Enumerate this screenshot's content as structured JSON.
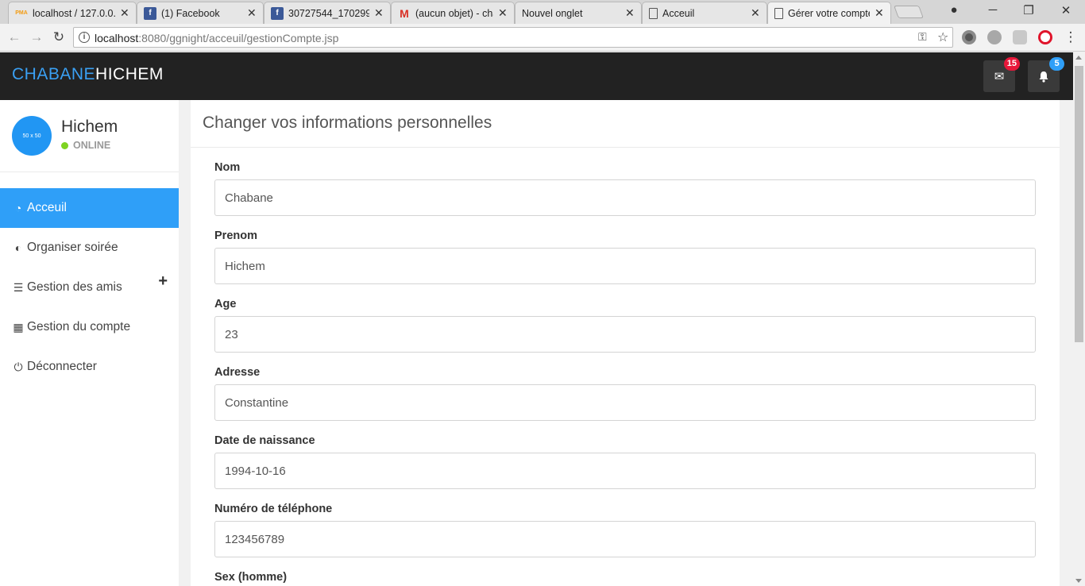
{
  "browser": {
    "tabs": [
      {
        "title": "localhost / 127.0.0.",
        "icon": "phpmyadmin-icon",
        "fav": "PMA"
      },
      {
        "title": "(1) Facebook",
        "icon": "facebook-icon",
        "fav": "f"
      },
      {
        "title": "30727544_170299",
        "icon": "facebook-icon",
        "fav": "f"
      },
      {
        "title": "(aucun objet) - cha",
        "icon": "gmail-icon",
        "fav": "M"
      },
      {
        "title": "Nouvel onglet",
        "icon": "",
        "fav": ""
      },
      {
        "title": "Acceuil",
        "icon": "document-icon",
        "fav": ""
      },
      {
        "title": "Gérer votre compte",
        "icon": "document-icon",
        "fav": ""
      }
    ],
    "url_host": "localhost",
    "url_path": ":8080/ggnight/acceuil/gestionCompte.jsp",
    "controls": {
      "minimize": "─",
      "restore": "❐",
      "close": "✕",
      "back": "←",
      "forward": "→",
      "reload": "↻",
      "menu": "⋮"
    }
  },
  "app": {
    "brand_part1": "CHABANE",
    "brand_part2": "HICHEM",
    "messages_count": "15",
    "notifications_count": "5",
    "colors": {
      "brand_blue": "#3aa0f3",
      "header_bg": "#222222",
      "active_nav": "#2f9ff8",
      "badge_red": "#e8173a",
      "badge_blue": "#2f9ff8",
      "online_green": "#7ed321"
    }
  },
  "sidebar": {
    "avatar_text": "50 x 50",
    "user_name": "Hichem",
    "status": "ONLINE",
    "items": [
      {
        "label": "Acceuil",
        "icon": "dashboard-icon"
      },
      {
        "label": "Organiser soirée",
        "icon": "toggle-icon"
      },
      {
        "label": "Gestion des amis",
        "icon": "bars-icon"
      },
      {
        "label": "Gestion du compte",
        "icon": "calendar-icon"
      },
      {
        "label": "Déconnecter",
        "icon": "power-icon"
      }
    ],
    "expand_symbol": "+"
  },
  "form": {
    "title": "Changer vos informations personnelles",
    "fields": [
      {
        "label": "Nom",
        "value": "Chabane"
      },
      {
        "label": "Prenom",
        "value": "Hichem"
      },
      {
        "label": "Age",
        "value": "23"
      },
      {
        "label": "Adresse",
        "value": "Constantine"
      },
      {
        "label": "Date de naissance",
        "value": "1994-10-16"
      },
      {
        "label": "Numéro de téléphone",
        "value": "123456789"
      },
      {
        "label": "Sex (homme)",
        "value": ""
      }
    ]
  }
}
